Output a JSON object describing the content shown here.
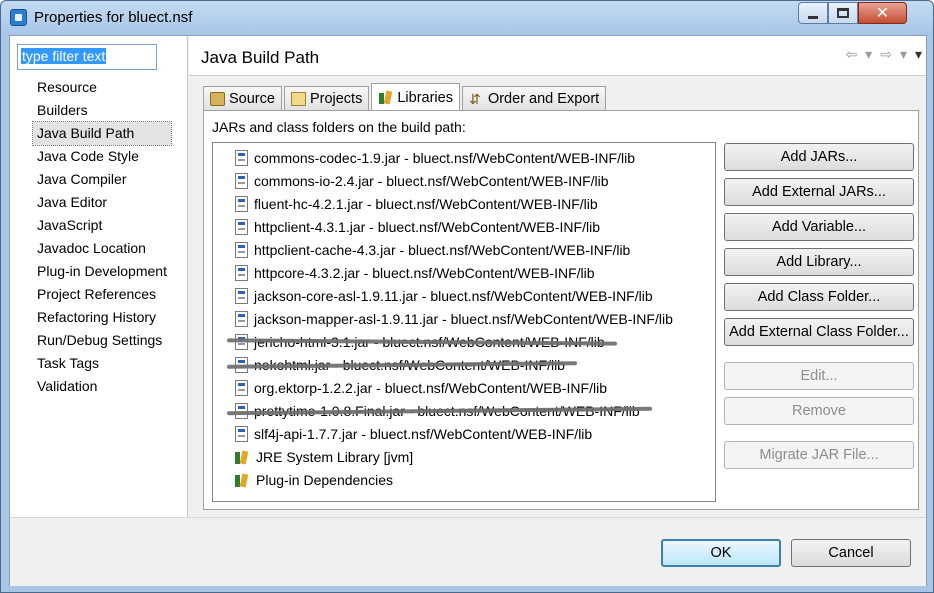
{
  "window": {
    "title": "Properties for bluect.nsf",
    "close_glyph": "✕"
  },
  "sidebar": {
    "filter_placeholder": "type filter text",
    "items": [
      {
        "label": "Resource"
      },
      {
        "label": "Builders"
      },
      {
        "label": "Java Build Path",
        "selected": true
      },
      {
        "label": "Java Code Style"
      },
      {
        "label": "Java Compiler"
      },
      {
        "label": "Java Editor"
      },
      {
        "label": "JavaScript"
      },
      {
        "label": "Javadoc Location"
      },
      {
        "label": "Plug-in Development"
      },
      {
        "label": "Project References"
      },
      {
        "label": "Refactoring History"
      },
      {
        "label": "Run/Debug Settings"
      },
      {
        "label": "Task Tags"
      },
      {
        "label": "Validation"
      }
    ]
  },
  "page": {
    "title": "Java Build Path",
    "nav": {
      "back": "⇦",
      "back_menu": "▾",
      "forward": "⇨",
      "forward_menu": "▾",
      "view_menu": "▾"
    }
  },
  "tabs": [
    {
      "label": "Source"
    },
    {
      "label": "Projects"
    },
    {
      "label": "Libraries",
      "active": true
    },
    {
      "label": "Order and Export",
      "icon_glyph": "⇵"
    }
  ],
  "libraries": {
    "heading": "JARs and class folders on the build path:",
    "entries": [
      {
        "label": "commons-codec-1.9.jar - bluect.nsf/WebContent/WEB-INF/lib",
        "kind": "jar",
        "struck": false
      },
      {
        "label": "commons-io-2.4.jar - bluect.nsf/WebContent/WEB-INF/lib",
        "kind": "jar",
        "struck": false
      },
      {
        "label": "fluent-hc-4.2.1.jar - bluect.nsf/WebContent/WEB-INF/lib",
        "kind": "jar",
        "struck": false
      },
      {
        "label": "httpclient-4.3.1.jar - bluect.nsf/WebContent/WEB-INF/lib",
        "kind": "jar",
        "struck": false
      },
      {
        "label": "httpclient-cache-4.3.jar - bluect.nsf/WebContent/WEB-INF/lib",
        "kind": "jar",
        "struck": false
      },
      {
        "label": "httpcore-4.3.2.jar - bluect.nsf/WebContent/WEB-INF/lib",
        "kind": "jar",
        "struck": false
      },
      {
        "label": "jackson-core-asl-1.9.11.jar - bluect.nsf/WebContent/WEB-INF/lib",
        "kind": "jar",
        "struck": false
      },
      {
        "label": "jackson-mapper-asl-1.9.11.jar - bluect.nsf/WebContent/WEB-INF/lib",
        "kind": "jar",
        "struck": false
      },
      {
        "label": "jericho-html-3.1.jar - bluect.nsf/WebContent/WEB-INF/lib",
        "kind": "jar",
        "struck": true
      },
      {
        "label": "nekohtml.jar - bluect.nsf/WebContent/WEB-INF/lib",
        "kind": "jar",
        "struck": true
      },
      {
        "label": "org.ektorp-1.2.2.jar - bluect.nsf/WebContent/WEB-INF/lib",
        "kind": "jar",
        "struck": false
      },
      {
        "label": "prettytime-1.0.8.Final.jar - bluect.nsf/WebContent/WEB-INF/lib",
        "kind": "jar",
        "struck": true
      },
      {
        "label": "slf4j-api-1.7.7.jar - bluect.nsf/WebContent/WEB-INF/lib",
        "kind": "jar",
        "struck": false
      },
      {
        "label": "JRE System Library [jvm]",
        "kind": "library",
        "struck": false
      },
      {
        "label": "Plug-in Dependencies",
        "kind": "library",
        "struck": false
      }
    ]
  },
  "buttons": {
    "add_jars": "Add JARs...",
    "add_external_jars": "Add External JARs...",
    "add_variable": "Add Variable...",
    "add_library": "Add Library...",
    "add_class_folder": "Add Class Folder...",
    "add_external_class_folder": "Add External Class Folder...",
    "edit": "Edit...",
    "remove": "Remove",
    "migrate_jar": "Migrate JAR File..."
  },
  "footer": {
    "ok": "OK",
    "cancel": "Cancel"
  }
}
